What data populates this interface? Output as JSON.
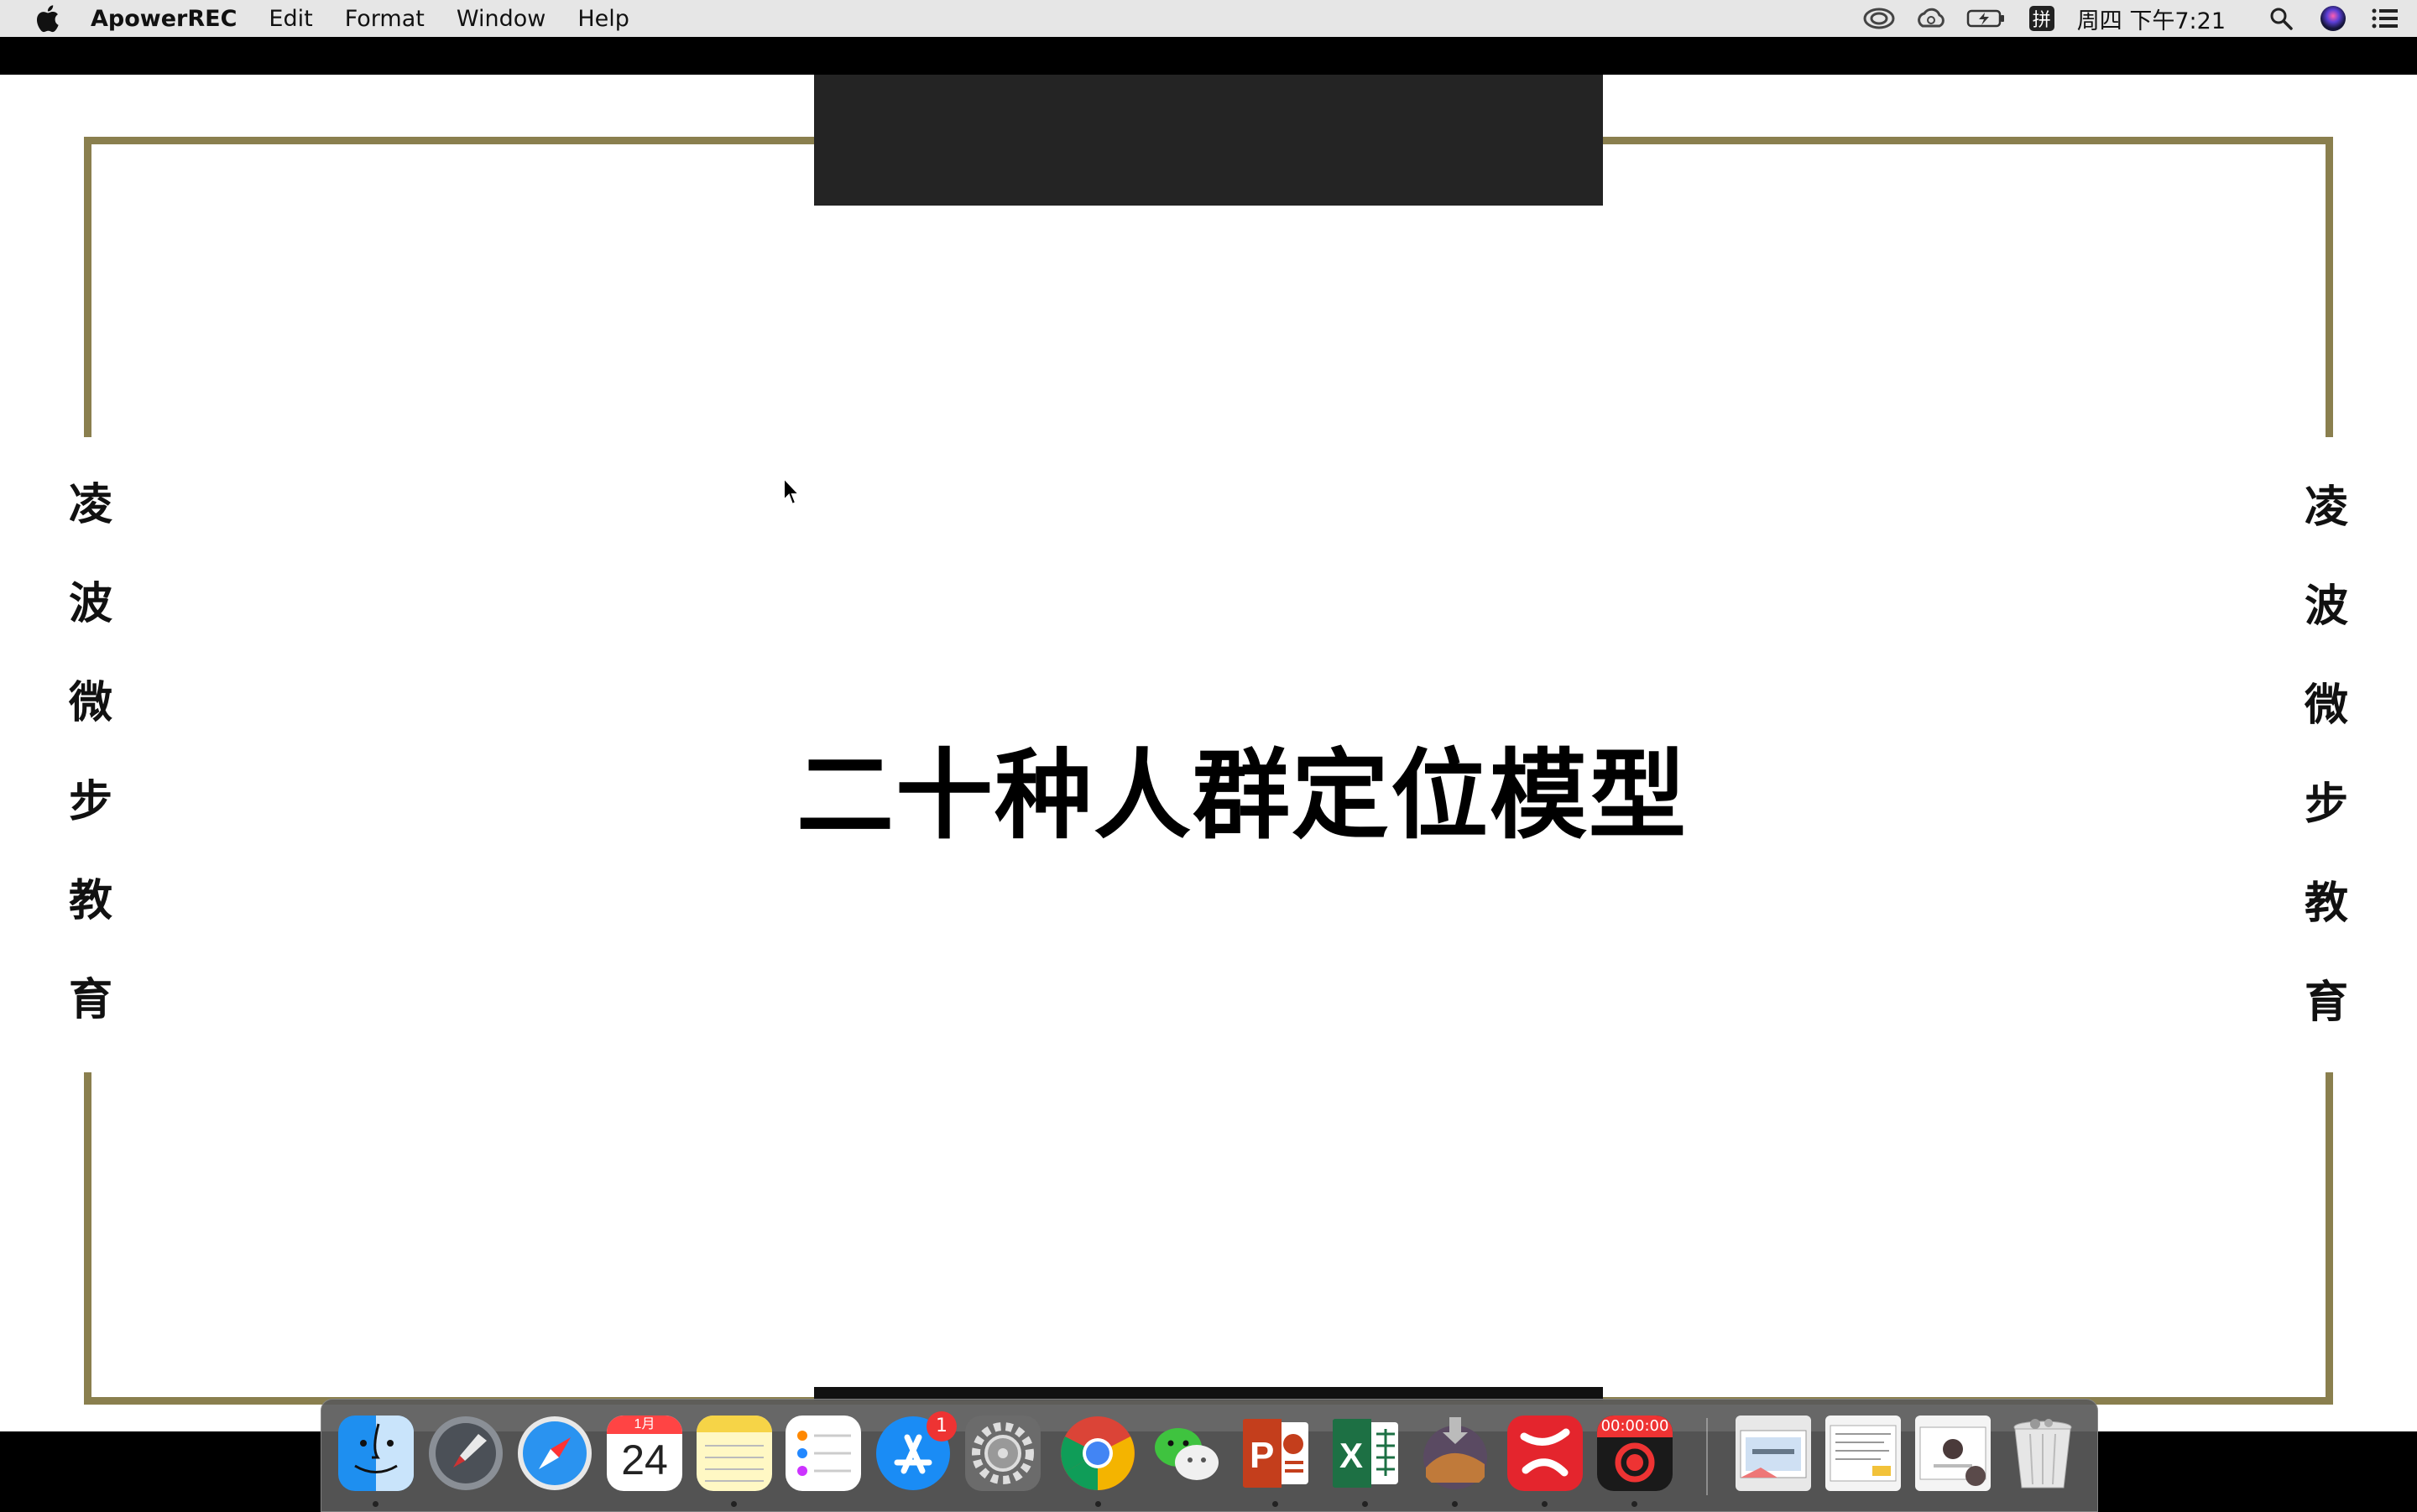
{
  "menubar": {
    "app_name": "ApowerREC",
    "items": [
      "Edit",
      "Format",
      "Window",
      "Help"
    ],
    "status_icons": [
      "creative-cloud-icon",
      "cloud-sync-icon",
      "battery-charging-icon",
      "input-method-pinyin-icon"
    ],
    "input_method_label": "拼",
    "clock": "周四 下午7:21",
    "right_icons": [
      "spotlight-search-icon",
      "siri-icon",
      "notification-center-icon"
    ]
  },
  "slide": {
    "title": "二十种人群定位模型",
    "left_vertical_text": [
      "凌",
      "波",
      "微",
      "步",
      "教",
      "育"
    ],
    "right_vertical_text": [
      "凌",
      "波",
      "微",
      "步",
      "教",
      "育"
    ],
    "frame_color": "#8a7f4e"
  },
  "dock": {
    "calendar_month": "1月",
    "calendar_day": "24",
    "app_store_badge": "1",
    "recorder_timer": "00:00:00",
    "apps": [
      "finder",
      "launchpad",
      "safari",
      "calendar",
      "notes",
      "reminders",
      "app-store",
      "system-preferences",
      "chrome",
      "wechat",
      "powerpoint",
      "excel",
      "macos-installer",
      "xmind",
      "apowerrec",
      "screenshot-1",
      "document-2",
      "photo-3",
      "trash"
    ]
  }
}
